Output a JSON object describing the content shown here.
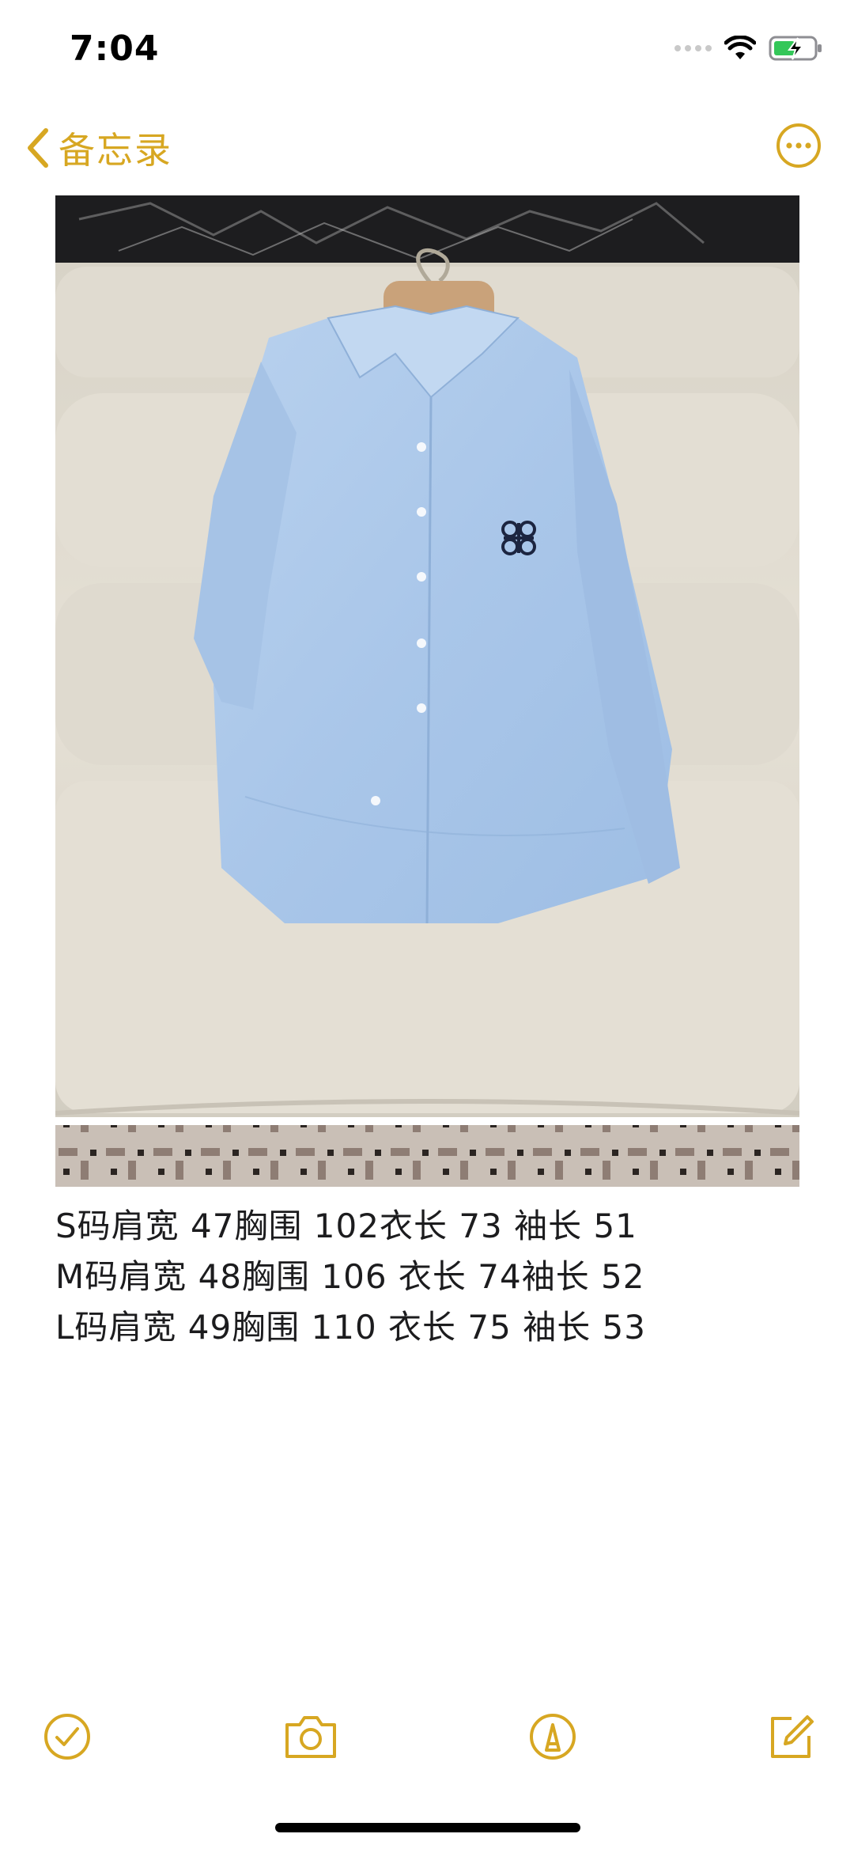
{
  "status_bar": {
    "time": "7:04",
    "icons": [
      "signal-dots-icon",
      "wifi-icon",
      "battery-charging-icon"
    ]
  },
  "nav": {
    "back_label": "备忘录",
    "back_icon": "chevron-left-icon",
    "more_icon": "ellipsis-circle-icon"
  },
  "note": {
    "image": "blue-shirt-photo",
    "lines": [
      "S码肩宽 47胸围 102衣长 73 袖长 51",
      "M码肩宽 48胸围 106 衣长 74袖长 52",
      "L码肩宽 49胸围 110 衣长 75 袖长 53"
    ]
  },
  "toolbar": {
    "icons": [
      "checklist-icon",
      "camera-icon",
      "markup-icon",
      "compose-icon"
    ]
  },
  "colors": {
    "accent": "#D7A722",
    "text": "#1c1c1e",
    "background": "#ffffff"
  }
}
